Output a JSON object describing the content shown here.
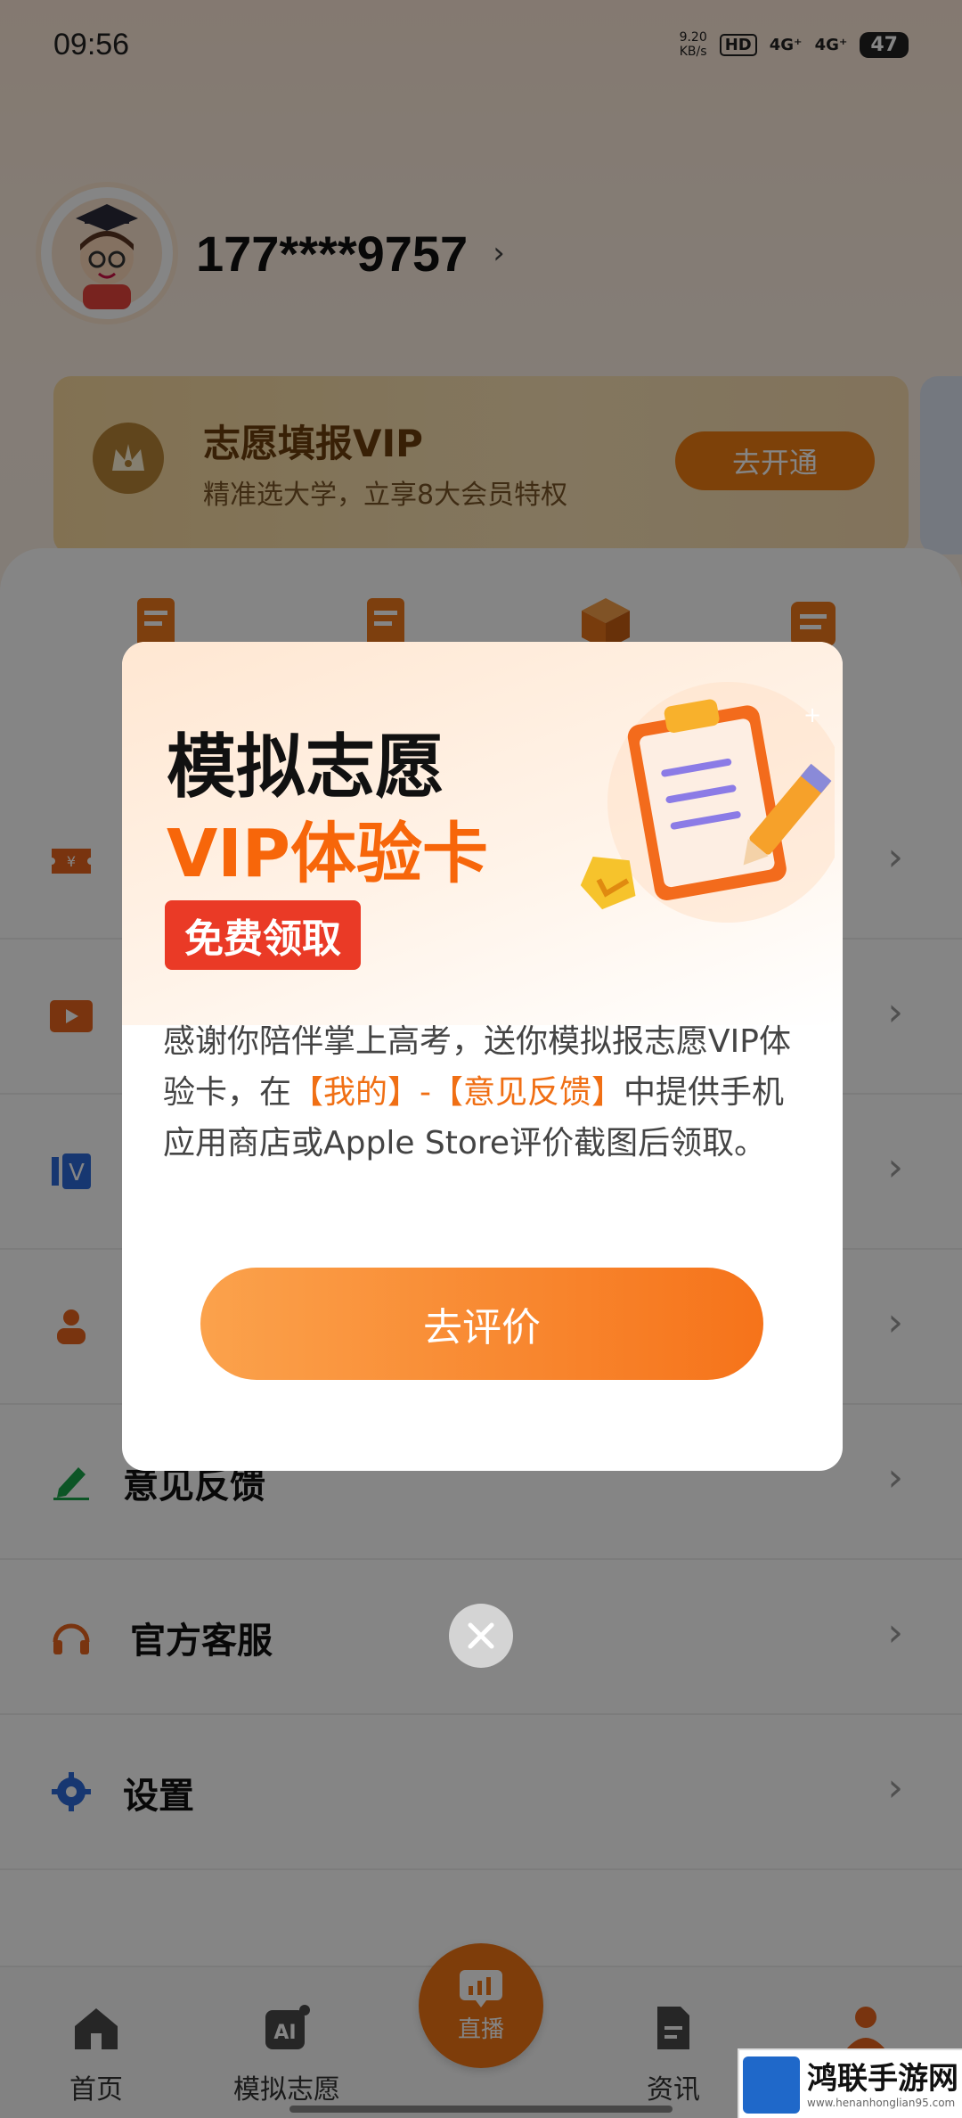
{
  "status_bar": {
    "time": "09:56",
    "net_speed_value": "9.20",
    "net_speed_unit": "KB/s",
    "hd": "HD",
    "sim1": "4G⁺",
    "sim2": "4G⁺",
    "battery": "47"
  },
  "profile": {
    "phone": "177****9757",
    "chevron": "›"
  },
  "vip_banner": {
    "title": "志愿填报VIP",
    "subtitle": "精准选大学，立享8大会员特权",
    "button": "去开通"
  },
  "menu": {
    "items": [
      {
        "label": "",
        "icon": "ticket-icon"
      },
      {
        "label": "",
        "icon": "video-icon"
      },
      {
        "label": "",
        "icon": "vip-v-icon"
      },
      {
        "label": "",
        "icon": "people-icon"
      },
      {
        "label": "意见反馈",
        "icon": "edit-icon"
      },
      {
        "label": "官方客服",
        "icon": "headset-icon"
      },
      {
        "label": "设置",
        "icon": "gear-icon"
      }
    ],
    "chevron": "›"
  },
  "tabs": {
    "home": "首页",
    "mock": "模拟志愿",
    "live": "直播",
    "news": "资讯",
    "ai_badge": "AI"
  },
  "modal": {
    "title_line1": "模拟志愿",
    "title_line2": "VIP体验卡",
    "badge": "免费领取",
    "body_part1": "感谢你陪伴掌上高考，送你模拟报志愿VIP体验卡，在",
    "body_highlight": "【我的】-【意见反馈】",
    "body_part2": "中提供手机应用商店或Apple Store评价截图后领取。",
    "button": "去评价"
  },
  "watermark": {
    "title": "鸿联手游网",
    "url": "www.henanhonglian95.com"
  },
  "colors": {
    "accent": "#f7660a",
    "badge_red": "#ea3a26",
    "vip_gold": "#f9d99e"
  }
}
